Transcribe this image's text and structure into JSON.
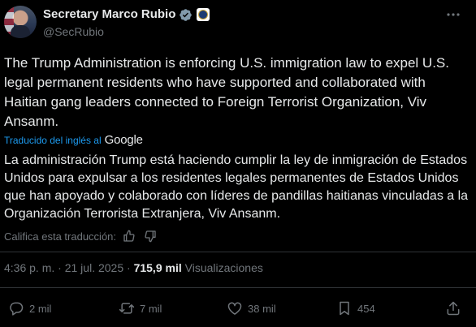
{
  "author": {
    "name": "Secretary Marco Rubio",
    "handle": "@SecRubio"
  },
  "tweet": {
    "text": "The Trump Administration is enforcing U.S. immigration law to expel U.S. legal permanent residents who have supported and collaborated with Haitian gang leaders connected to Foreign Terrorist Organization, Viv Ansanm.",
    "translated_label": "Traducido del inglés al",
    "translator": "Google",
    "translation": "La administración Trump está haciendo cumplir la ley de inmigración de Estados Unidos para expulsar a los residentes legales permanentes de Estados Unidos que han apoyado y colaborado con líderes de pandillas haitianas vinculadas a la Organización Terrorista Extranjera, Viv Ansanm.",
    "rate_label": "Califica esta traducción:"
  },
  "meta": {
    "time": "4:36 p. m.",
    "separator": "·",
    "date": "21 jul. 2025",
    "views_count": "715,9 mil",
    "views_label": "Visualizaciones"
  },
  "actions": {
    "replies": "2 mil",
    "reposts": "7 mil",
    "likes": "38 mil",
    "bookmarks": "454"
  },
  "colors": {
    "background": "#000000",
    "text": "#e7e9ea",
    "muted": "#71767b",
    "link": "#1d9bf0",
    "verified_badge": "#829aab",
    "divider": "#2f3336"
  },
  "icons": {
    "verified": "verified-badge-icon",
    "affiliate": "state-department-seal-icon",
    "more": "more-dots-icon",
    "thumbs_up": "thumbs-up-icon",
    "thumbs_down": "thumbs-down-icon",
    "reply": "reply-icon",
    "repost": "repost-icon",
    "like": "heart-icon",
    "bookmark": "bookmark-icon",
    "share": "share-icon"
  }
}
